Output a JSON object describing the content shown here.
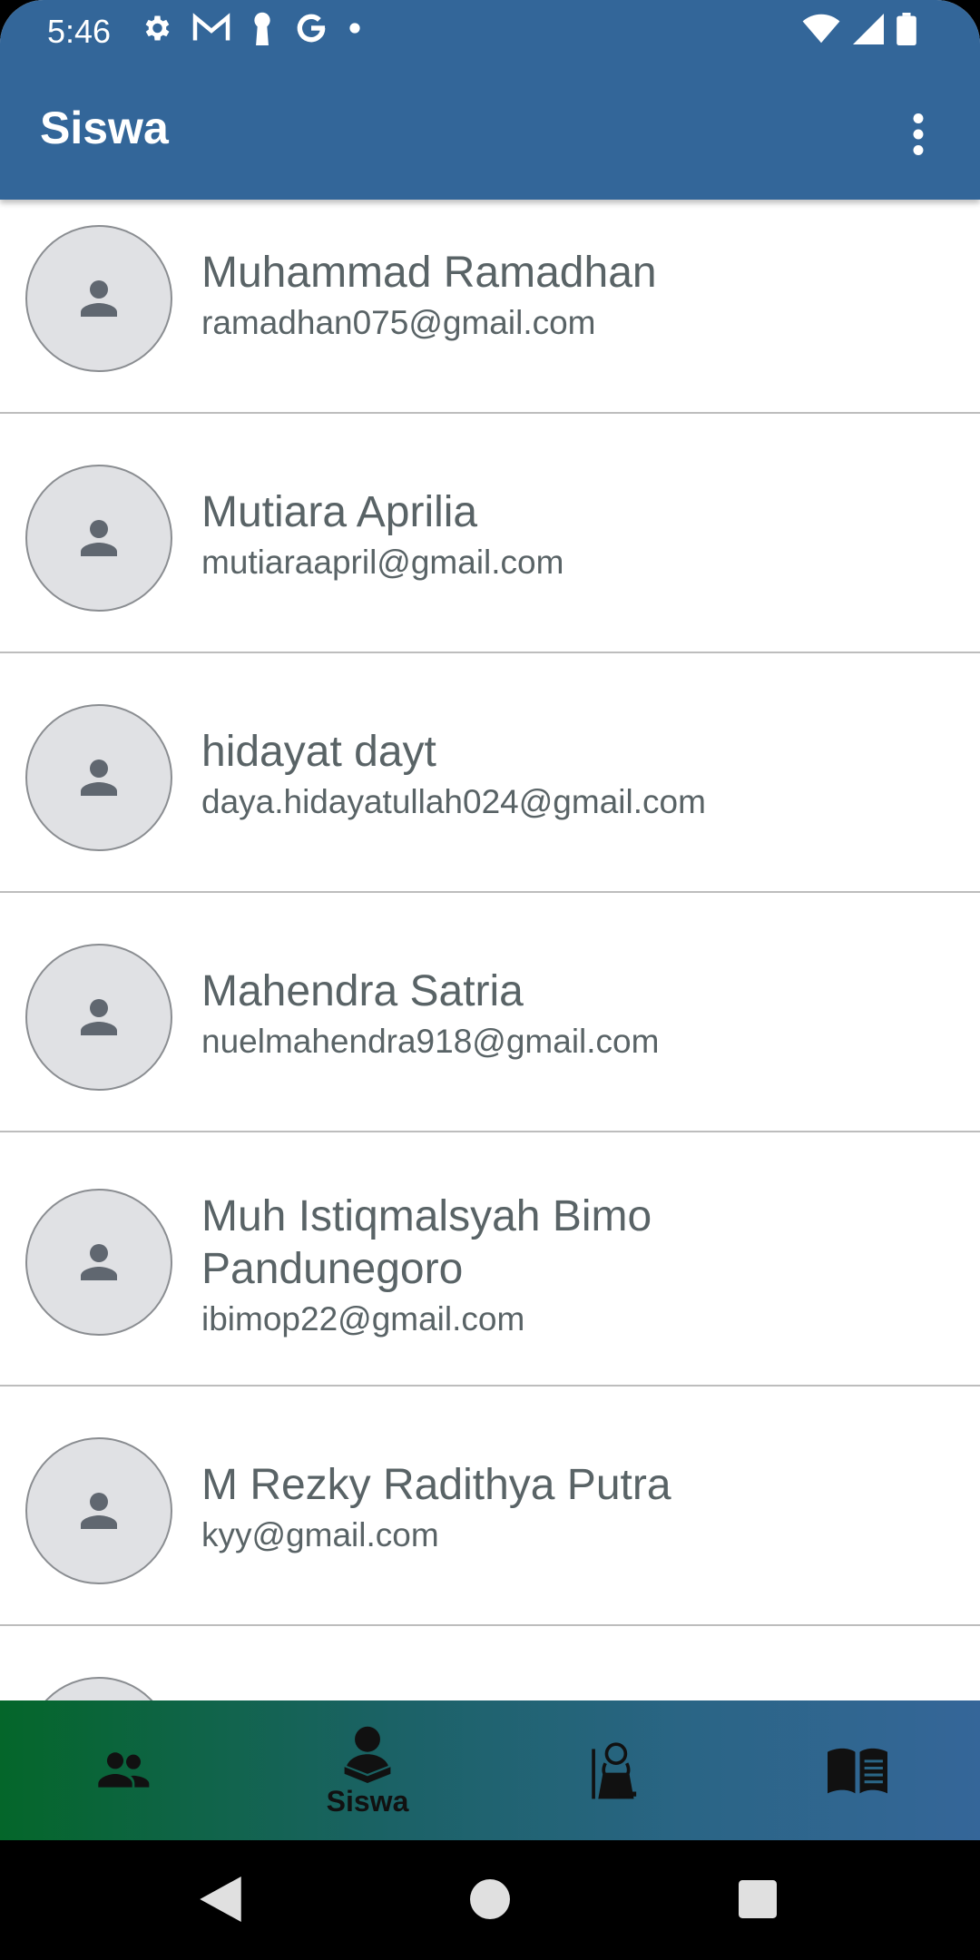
{
  "status_bar": {
    "time": "5:46",
    "left_icons": [
      "gear-icon",
      "gmail-icon",
      "keyhole-icon",
      "google-icon",
      "dot-icon"
    ],
    "right_icons": [
      "wifi-icon",
      "signal-icon",
      "battery-icon"
    ]
  },
  "app_bar": {
    "title": "Siswa",
    "background": "#336699",
    "menu_icon": "more-vert-icon"
  },
  "students": [
    {
      "name": "Muhammad Ramadhan",
      "email": "ramadhan075@gmail.com"
    },
    {
      "name": "Mutiara Aprilia",
      "email": "mutiaraapril@gmail.com"
    },
    {
      "name": "hidayat dayt",
      "email": "daya.hidayatullah024@gmail.com"
    },
    {
      "name": "Mahendra Satria",
      "email": "nuelmahendra918@gmail.com"
    },
    {
      "name": "Muh Istiqmalsyah Bimo Pandunegoro",
      "email": "ibimop22@gmail.com"
    },
    {
      "name": "M Rezky Radithya Putra",
      "email": "kyy@gmail.com"
    },
    {
      "name": "",
      "email": ""
    }
  ],
  "bottom_nav": {
    "items": [
      {
        "icon": "people-icon",
        "label": ""
      },
      {
        "icon": "student-icon",
        "label": "Siswa"
      },
      {
        "icon": "teacher-icon",
        "label": ""
      },
      {
        "icon": "book-icon",
        "label": ""
      }
    ],
    "gradient_start": "#04662a",
    "gradient_end": "#356699"
  },
  "system_nav": {
    "buttons": [
      "back-icon",
      "home-icon",
      "recents-icon"
    ]
  }
}
